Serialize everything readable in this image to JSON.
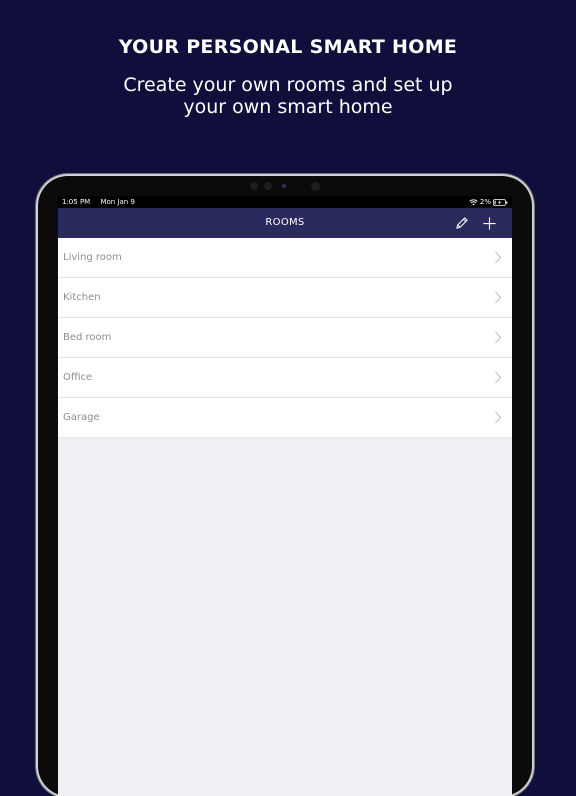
{
  "promo": {
    "headline": "YOUR PERSONAL SMART HOME",
    "subline_1": "Create your own rooms and set up",
    "subline_2": "your own smart home"
  },
  "status_bar": {
    "time": "1:05 PM",
    "date": "Mon Jan 9",
    "battery": "2%",
    "icons": [
      "wifi-icon",
      "battery-icon"
    ]
  },
  "nav": {
    "title": "ROOMS",
    "edit_icon": "pencil-icon",
    "add_icon": "plus-icon"
  },
  "rooms": [
    {
      "label": "Living room"
    },
    {
      "label": "Kitchen"
    },
    {
      "label": "Bed room"
    },
    {
      "label": "Office"
    },
    {
      "label": "Garage"
    }
  ],
  "colors": {
    "background": "#100f3b",
    "nav_bar": "#2b2a5c",
    "list_background": "#ffffff",
    "screen_background": "#efeff4",
    "row_text": "#8e8e93"
  }
}
